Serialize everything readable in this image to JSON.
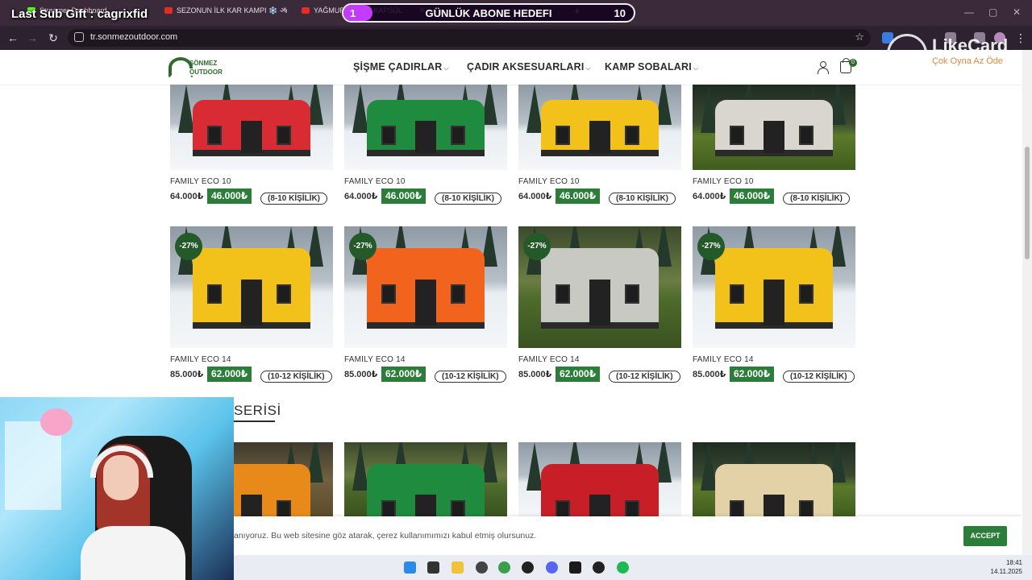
{
  "overlay": {
    "last_sub": "Last Sub Gift : cagrixfid",
    "goal_current": "1",
    "goal_label": "GÜNLÜK ABONE HEDEFI",
    "goal_target": "10",
    "goal_fraction": 0.1
  },
  "browser": {
    "tabs": [
      {
        "label": "Streamer Dashboard"
      },
      {
        "label": "SEZONUN İLK KAR KAMPI ❄️ - Yo"
      },
      {
        "label": "YAĞMURDA DEV KAPSÜL"
      }
    ],
    "url": "tr.sonmezoutdoor.com"
  },
  "likecard": {
    "name": "LikeCard",
    "tagline": "Çok Oyna  Az Öde"
  },
  "site": {
    "logo_line1": "SÖNMEZ",
    "logo_line2": "OUTDOOR",
    "nav": [
      "ŞİŞME ÇADIRLAR",
      "ÇADIR AKSESUARLARI",
      "KAMP SOBALARI"
    ],
    "cart_count": "0"
  },
  "products": [
    {
      "name": "FAMILY ECO 10",
      "old_price": "64.000₺",
      "new_price": "46.000₺",
      "capacity": "(8-10 KİŞİLİK)",
      "color": "#d92b33",
      "scene": "snow"
    },
    {
      "name": "FAMILY ECO 10",
      "old_price": "64.000₺",
      "new_price": "46.000₺",
      "capacity": "(8-10 KİŞİLİK)",
      "color": "#1f8b3e",
      "scene": "snow"
    },
    {
      "name": "FAMILY ECO 10",
      "old_price": "64.000₺",
      "new_price": "46.000₺",
      "capacity": "(8-10 KİŞİLİK)",
      "color": "#f2c11a",
      "scene": "snow"
    },
    {
      "name": "FAMILY ECO 10",
      "old_price": "64.000₺",
      "new_price": "46.000₺",
      "capacity": "(8-10 KİŞİLİK)",
      "color": "#d8d6cf",
      "scene": "grass"
    },
    {
      "name": "FAMILY ECO 14",
      "old_price": "85.000₺",
      "new_price": "62.000₺",
      "capacity": "(10-12 KİŞİLİK)",
      "discount": "-27%",
      "color": "#f2c11a",
      "scene": "snow"
    },
    {
      "name": "FAMILY ECO 14",
      "old_price": "85.000₺",
      "new_price": "62.000₺",
      "capacity": "(10-12 KİŞİLİK)",
      "discount": "-27%",
      "color": "#f2641e",
      "scene": "snow"
    },
    {
      "name": "FAMILY ECO 14",
      "old_price": "85.000₺",
      "new_price": "62.000₺",
      "capacity": "(10-12 KİŞİLİK)",
      "discount": "-27%",
      "color": "#c9c9c4",
      "scene": "forest"
    },
    {
      "name": "FAMILY ECO 14",
      "old_price": "85.000₺",
      "new_price": "62.000₺",
      "capacity": "(10-12 KİŞİLİK)",
      "discount": "-27%",
      "color": "#f2c11a",
      "scene": "snow"
    }
  ],
  "section_title": "SERİSİ",
  "next_row_colors": [
    {
      "color": "#e88a1a",
      "scene": "autumn"
    },
    {
      "color": "#1f8b3e",
      "scene": "forest"
    },
    {
      "color": "#c81e27",
      "scene": "snow"
    },
    {
      "color": "#e3d2a8",
      "scene": "grass"
    }
  ],
  "cookie": {
    "text": "anıyoruz. Bu web sitesine göz atarak, çerez kullanımımızı kabul etmiş olursunuz.",
    "accept": "ACCEPT"
  },
  "taskbar": {
    "time": "18:41",
    "date": "14.11.2025"
  }
}
